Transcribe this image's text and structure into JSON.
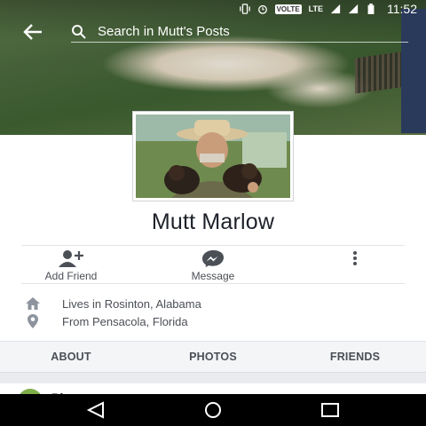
{
  "status_bar": {
    "volte": "VOLTE",
    "network": "LTE",
    "time": "11:52"
  },
  "search": {
    "placeholder": "Search in Mutt's Posts"
  },
  "profile": {
    "name": "Mutt Marlow"
  },
  "actions": {
    "add_friend": "Add Friend",
    "message": "Message",
    "more_icon": "more-vertical-icon"
  },
  "info": {
    "lives_in": "Lives in Rosinton, Alabama",
    "from": "From Pensacola, Florida"
  },
  "tabs": [
    {
      "label": "ABOUT"
    },
    {
      "label": "PHOTOS"
    },
    {
      "label": "FRIENDS"
    }
  ],
  "peek_text": "Ph",
  "colors": {
    "accent": "#4b4f56",
    "tab_bar_bg": "#f4f5f7"
  }
}
